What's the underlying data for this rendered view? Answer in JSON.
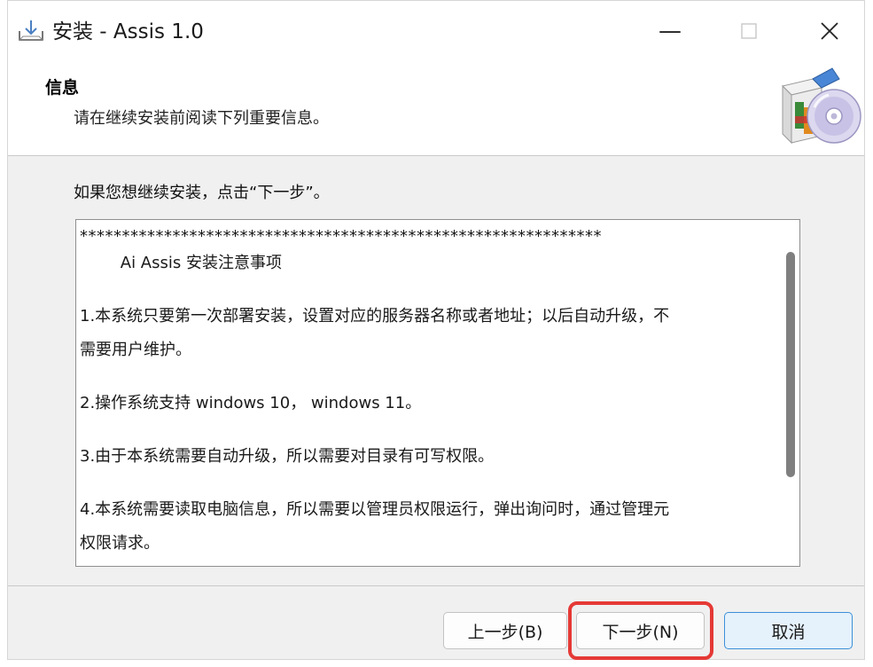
{
  "window": {
    "title": "安装 - Assis 1.0",
    "controls": {
      "minimize": "—",
      "maximize": "☐",
      "close": "✕"
    }
  },
  "header": {
    "title": "信息",
    "subtitle": "请在继续安装前阅读下列重要信息。",
    "icon": "setup-box-cd-icon"
  },
  "instruction": "如果您想继续安装，点击“下一步”。",
  "memo": {
    "lines": [
      "**************************************************************",
      "        Ai Assis 安装注意事项",
      "1.本系统只要第一次部署安装，设置对应的服务器名称或者地址；以后自动升级，不",
      "需要用户维护。",
      "2.操作系统支持 windows 10， windows 11。",
      "3.由于本系统需要自动升级，所以需要对目录有可写权限。",
      "4.本系统需要读取电脑信息，所以需要以管理员权限运行，弹出询问时，通过管理元",
      "权限请求。"
    ]
  },
  "buttons": {
    "back": "上一步(B)",
    "next": "下一步(N)",
    "cancel": "取消"
  },
  "colors": {
    "highlight": "#e53935",
    "cancel_border": "#3b8fd8",
    "cancel_bg": "#e5f1fb"
  }
}
